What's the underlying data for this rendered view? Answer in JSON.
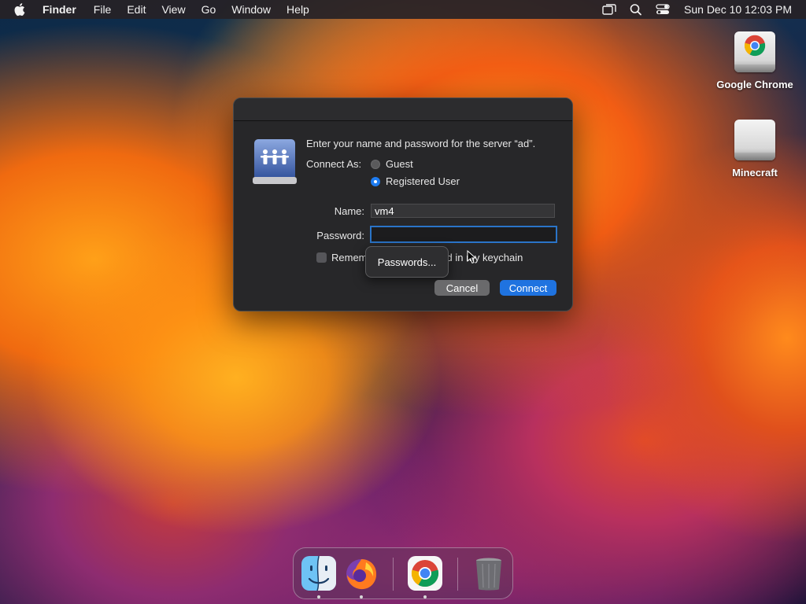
{
  "menubar": {
    "app_name": "Finder",
    "items": [
      "File",
      "Edit",
      "View",
      "Go",
      "Window",
      "Help"
    ],
    "clock": "Sun Dec 10  12:03 PM",
    "status_icons": [
      "screen-mirroring-icon",
      "search-icon",
      "control-center-icon"
    ]
  },
  "desktop": {
    "icons": [
      {
        "label": "Google Chrome",
        "icon": "chrome-drive-icon"
      },
      {
        "label": "Minecraft",
        "icon": "drive-icon"
      }
    ]
  },
  "dialog": {
    "prompt": "Enter your name and password for the server “ad”.",
    "connect_as_label": "Connect As:",
    "options": [
      "Guest",
      "Registered User"
    ],
    "selected_option": "Registered User",
    "name_label": "Name:",
    "name_value": "vm4",
    "password_label": "Password:",
    "password_value": "",
    "remember_left": "Remem",
    "remember_right": "d in my keychain",
    "remember_checked": false,
    "popover_label": "Passwords...",
    "cancel_label": "Cancel",
    "connect_label": "Connect",
    "accent_color": "#1f73e0"
  },
  "dock": {
    "apps": [
      "finder-icon",
      "firefox-icon",
      "chrome-icon",
      "trash-icon"
    ],
    "running": [
      "finder",
      "firefox",
      "chrome"
    ]
  }
}
